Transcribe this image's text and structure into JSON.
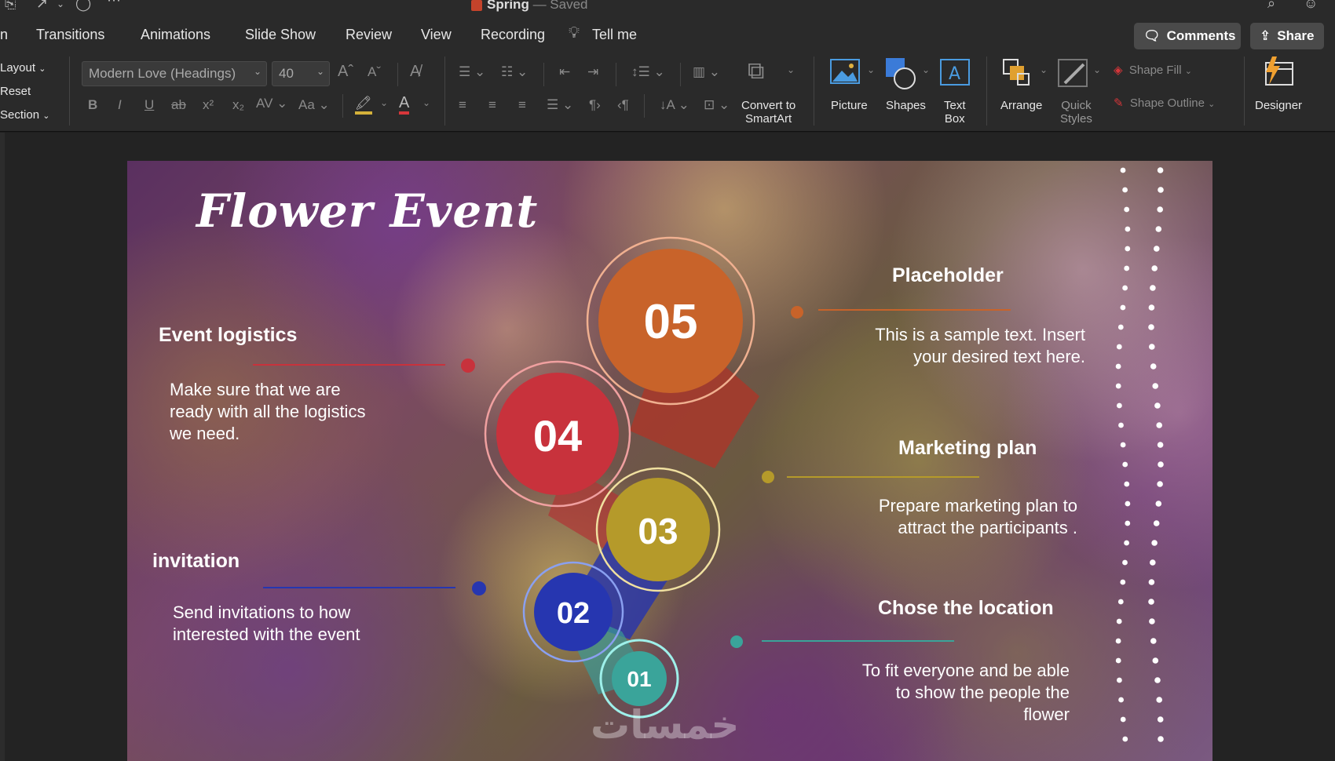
{
  "window": {
    "title": "Spring",
    "status": "— Saved"
  },
  "tabs": [
    {
      "label": "n"
    },
    {
      "label": "Transitions"
    },
    {
      "label": "Animations"
    },
    {
      "label": "Slide Show"
    },
    {
      "label": "Review"
    },
    {
      "label": "View"
    },
    {
      "label": "Recording"
    },
    {
      "label": "Tell me"
    }
  ],
  "top_buttons": {
    "comments": "Comments",
    "share": "Share"
  },
  "ribbon": {
    "slides_group": {
      "layout": "Layout",
      "reset": "Reset",
      "section": "Section"
    },
    "font": {
      "name": "Modern Love (Headings)",
      "size": "40"
    },
    "convert_smartart": [
      "Convert to",
      "SmartArt"
    ],
    "picture": "Picture",
    "shapes": "Shapes",
    "text_box": [
      "Text",
      "Box"
    ],
    "arrange": "Arrange",
    "quick_styles": [
      "Quick",
      "Styles"
    ],
    "shape_fill": "Shape Fill",
    "shape_outline": "Shape Outline",
    "designer": "Designer"
  },
  "slide": {
    "title": "Flower Event",
    "steps": [
      {
        "number": "05",
        "color": "#c8632a"
      },
      {
        "number": "04",
        "color": "#c8323c"
      },
      {
        "number": "03",
        "color": "#b59a2a"
      },
      {
        "number": "02",
        "color": "#2636b0"
      },
      {
        "number": "01",
        "color": "#3aa49a"
      }
    ],
    "items": {
      "placeholder": {
        "heading": "Placeholder",
        "body": [
          "This is a sample text. Insert",
          "your desired text here."
        ]
      },
      "event_logistics": {
        "heading": "Event logistics",
        "body": [
          "Make sure that we are",
          "ready with all the logistics",
          "we need."
        ]
      },
      "marketing": {
        "heading": "Marketing plan",
        "body": [
          "Prepare marketing plan to",
          "attract the participants ."
        ]
      },
      "invitation": {
        "heading": "invitation",
        "body": [
          "Send invitations to how",
          "interested with the event"
        ]
      },
      "location": {
        "heading": "Chose the location",
        "body": [
          "To fit everyone and be able",
          "to show the people the",
          "flower"
        ]
      }
    },
    "watermark": "خمسات"
  }
}
